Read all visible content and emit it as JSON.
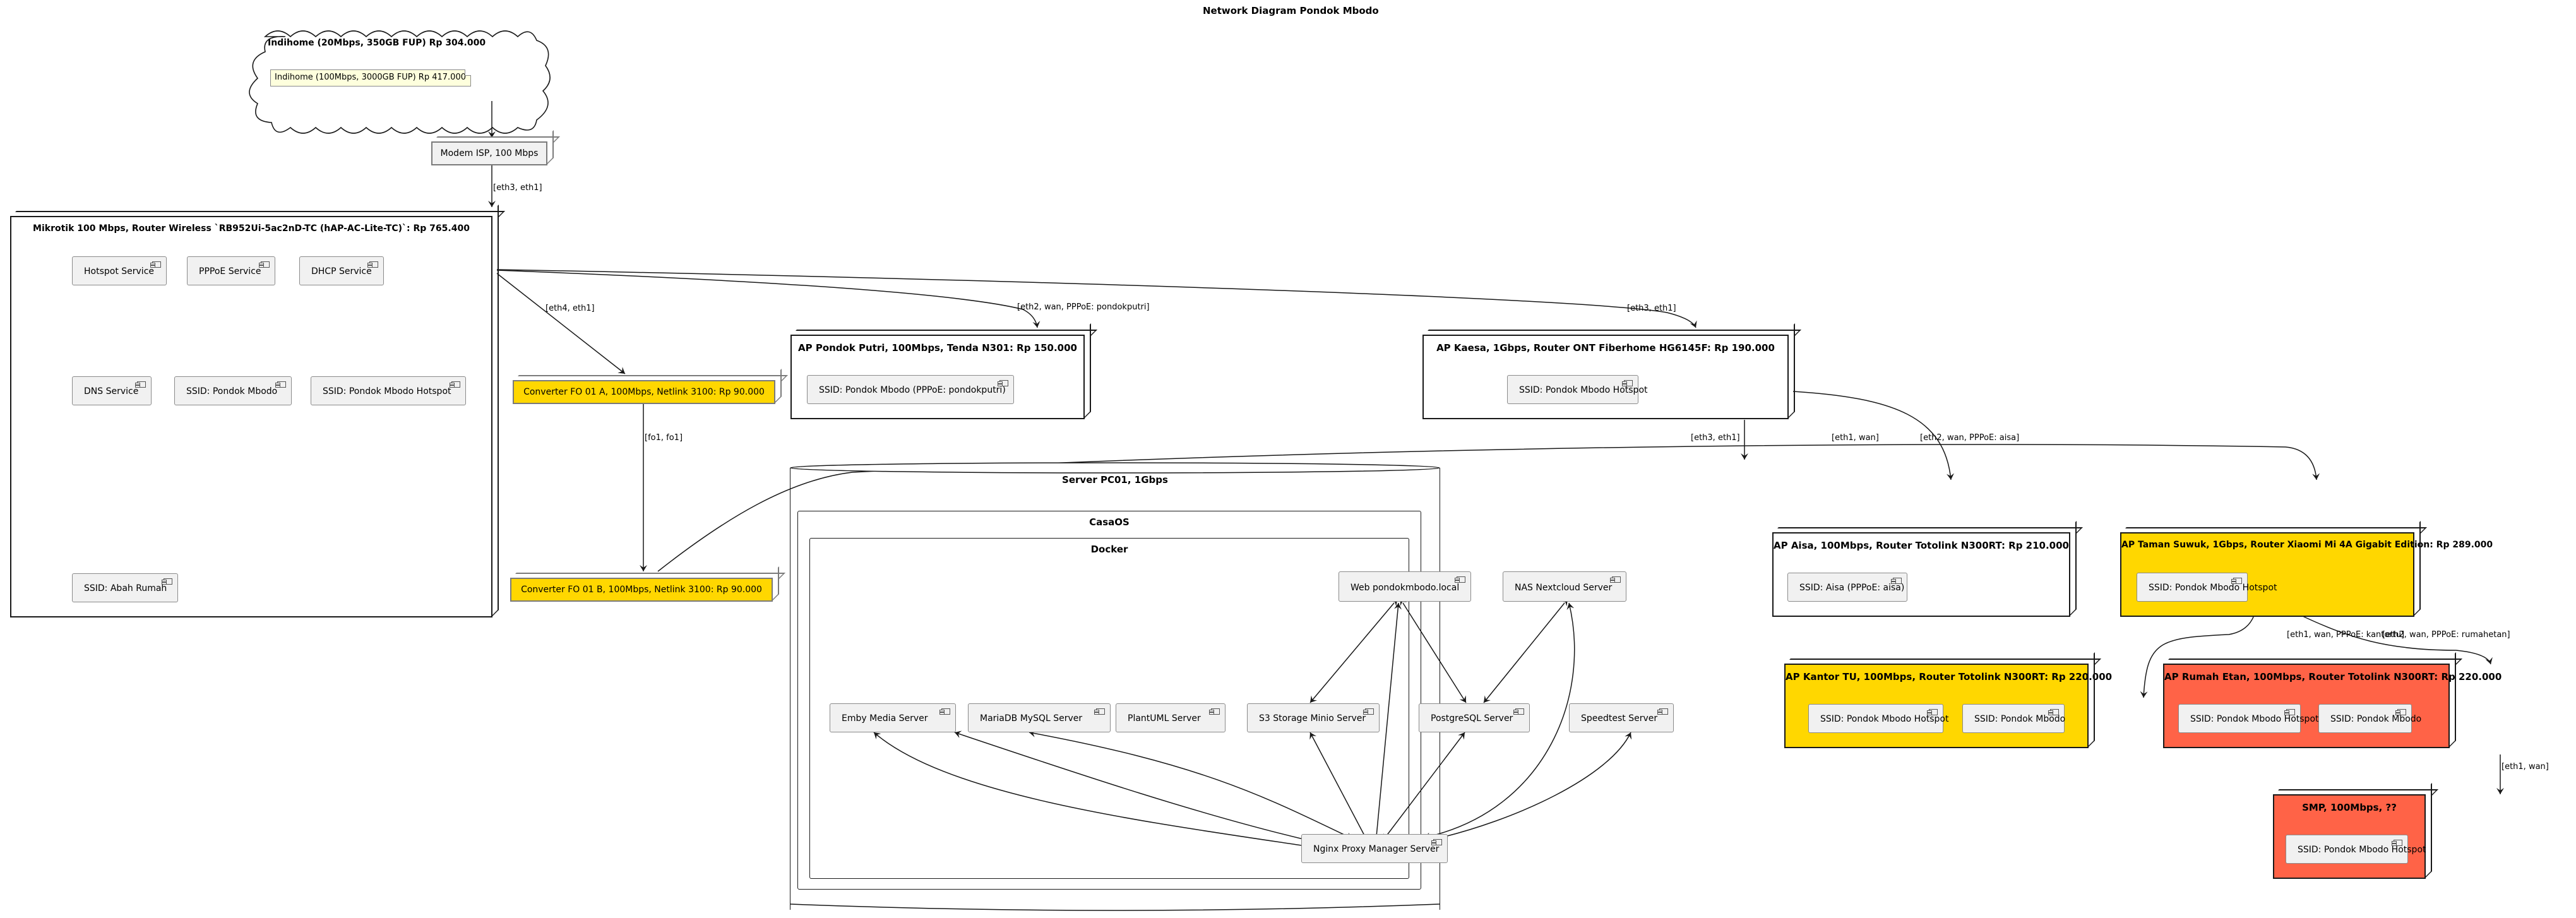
{
  "diagram": {
    "title": "Network Diagram Pondok Mbodo",
    "colors": {
      "highlight_yellow": "#FFD700",
      "highlight_red": "#FF6347",
      "component_fill": "#F1F1F1",
      "note_fill": "#FEFFDD"
    }
  },
  "cloud": {
    "title": "Indihome (20Mbps, 350GB FUP) Rp 304.000",
    "note": "Indihome (100Mbps, 3000GB FUP) Rp 417.000"
  },
  "nodes": {
    "modem": {
      "label": "Modem ISP, 100 Mbps"
    },
    "mikrotik": {
      "title": "Mikrotik 100 Mbps, Router Wireless `RB952Ui-5ac2nD-TC (hAP-AC-Lite-TC)`: Rp 765.400",
      "components": [
        "Hotspot Service",
        "PPPoE Service",
        "DHCP Service",
        "DNS Service",
        "SSID: Pondok Mbodo",
        "SSID: Pondok Mbodo Hotspot",
        "SSID: Abah Rumah"
      ]
    },
    "converter_a": {
      "label": "Converter FO 01 A, 100Mbps, Netlink 3100: Rp 90.000"
    },
    "converter_b": {
      "label": "Converter FO 01 B, 100Mbps, Netlink 3100: Rp 90.000"
    },
    "ap_putri": {
      "title": "AP Pondok Putri, 100Mbps, Tenda N301: Rp 150.000",
      "components": [
        "SSID: Pondok Mbodo (PPPoE: pondokputri)"
      ]
    },
    "ap_kaesa": {
      "title": "AP Kaesa, 1Gbps, Router ONT Fiberhome HG6145F: Rp 190.000",
      "components": [
        "SSID: Pondok Mbodo Hotspot"
      ]
    },
    "server": {
      "title": "Server PC01, 1Gbps",
      "casaos_title": "CasaOS",
      "docker_title": "Docker",
      "components": {
        "web": "Web pondokmbodo.local",
        "nas": "NAS Nextcloud Server",
        "emby": "Emby Media Server",
        "mariadb": "MariaDB MySQL Server",
        "plantuml": "PlantUML Server",
        "s3": "S3 Storage Minio Server",
        "postgres": "PostgreSQL Server",
        "speedtest": "Speedtest Server",
        "nginx": "Nginx Proxy Manager Server"
      }
    },
    "ap_aisa": {
      "title": "AP Aisa, 100Mbps, Router Totolink N300RT: Rp 210.000",
      "components": [
        "SSID: Aisa (PPPoE: aisa)"
      ]
    },
    "ap_taman": {
      "title": "AP Taman Suwuk, 1Gbps, Router Xiaomi Mi 4A Gigabit Edition: Rp 289.000",
      "components": [
        "SSID: Pondok Mbodo Hotspot"
      ]
    },
    "ap_kantor": {
      "title": "AP Kantor TU, 100Mbps, Router Totolink N300RT: Rp 220.000",
      "components": [
        "SSID: Pondok Mbodo Hotspot",
        "SSID: Pondok Mbodo"
      ]
    },
    "ap_etan": {
      "title": "AP Rumah Etan, 100Mbps, Router Totolink N300RT: Rp 220.000",
      "components": [
        "SSID: Pondok Mbodo Hotspot",
        "SSID: Pondok Mbodo"
      ]
    },
    "smp": {
      "title": "SMP, 100Mbps, ??",
      "components": [
        "SSID: Pondok Mbodo Hotspot"
      ]
    }
  },
  "edges": {
    "modem_mikrotik": "[eth3, eth1]",
    "mikrotik_conv_a": "[eth4, eth1]",
    "mikrotik_putri": "[eth2, wan, PPPoE: pondokputri]",
    "mikrotik_kaesa": "[eth3, eth1]",
    "conv_a_conv_b": "[fo1, fo1]",
    "kaesa_server": "[eth3, eth1]",
    "conv_b_taman": "[eth1, wan]",
    "kaesa_aisa": "[eth2, wan, PPPoE: aisa]",
    "taman_kantor": "[eth1, wan, PPPoE: kantortu]",
    "taman_etan": "[eth2, wan, PPPoE: rumahetan]",
    "etan_smp": "[eth1, wan]"
  }
}
